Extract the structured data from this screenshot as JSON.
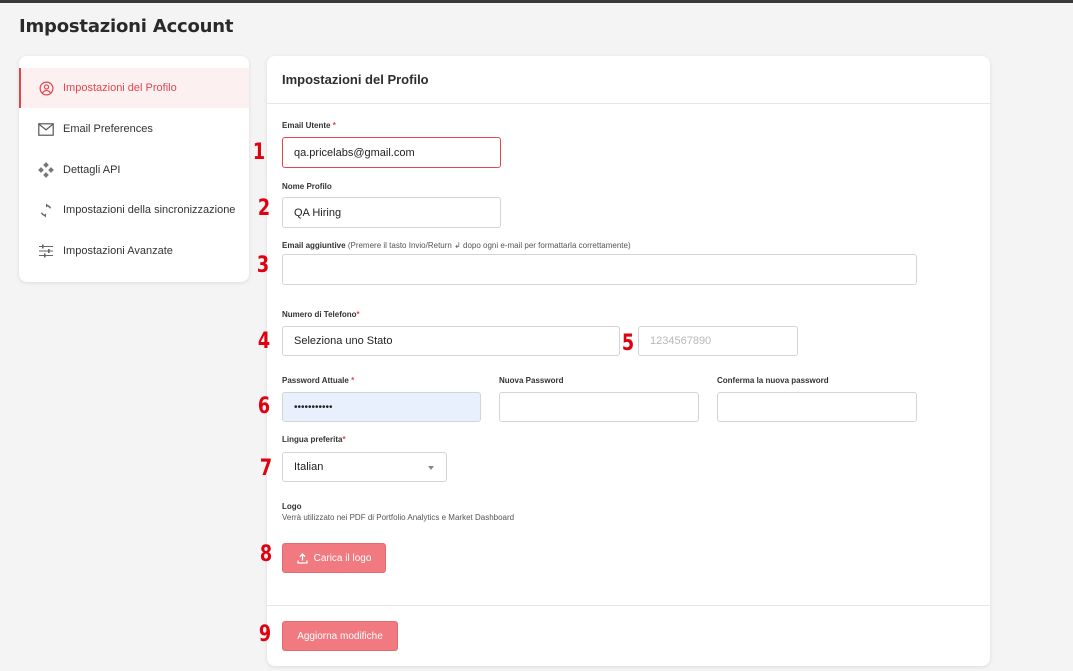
{
  "page_title": "Impostazioni Account",
  "sidebar": {
    "items": [
      {
        "label": "Impostazioni del Profilo",
        "icon": "user-circle-icon",
        "active": true
      },
      {
        "label": "Email Preferences",
        "icon": "mail-icon"
      },
      {
        "label": "Dettagli API",
        "icon": "api-diamond-icon"
      },
      {
        "label": "Impostazioni della sincronizzazione",
        "icon": "sync-icon"
      },
      {
        "label": "Impostazioni Avanzate",
        "icon": "sliders-icon"
      }
    ]
  },
  "form": {
    "title": "Impostazioni del Profilo",
    "email": {
      "label": "Email Utente",
      "required": "*",
      "value": "qa.pricelabs@gmail.com"
    },
    "profile_name": {
      "label": "Nome Profilo",
      "value": "QA Hiring"
    },
    "extra_emails": {
      "label": "Email aggiuntive",
      "hint": "(Premere il tasto Invio/Return ↲ dopo ogni e-mail per formattarla correttamente)",
      "value": ""
    },
    "phone": {
      "label": "Numero di Telefono",
      "required": "*",
      "country_value": "Seleziona uno Stato",
      "number_placeholder": "1234567890"
    },
    "current_password": {
      "label": "Password Attuale",
      "required": "*",
      "value": "•••••••••••"
    },
    "new_password": {
      "label": "Nuova Password",
      "value": ""
    },
    "confirm_password": {
      "label": "Conferma la nuova password",
      "value": ""
    },
    "language": {
      "label": "Lingua preferita",
      "required": "*",
      "value": "Italian"
    },
    "logo": {
      "label": "Logo",
      "subtext": "Verrà utilizzato nei PDF di Portfolio Analytics e Market Dashboard",
      "upload_label": "Carica il logo"
    },
    "submit_label": "Aggiorna modifiche"
  },
  "annotations": [
    "1",
    "2",
    "3",
    "4",
    "5",
    "6",
    "7",
    "8",
    "9"
  ],
  "colors": {
    "accent": "#e0464e",
    "button": "#f07a80",
    "annotation": "#e00010",
    "autofill": "#e8f0fe"
  }
}
